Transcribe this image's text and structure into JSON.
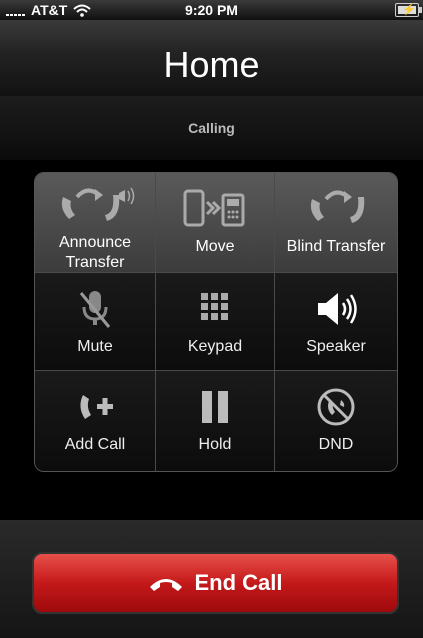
{
  "status_bar": {
    "carrier": "AT&T",
    "time": "9:20 PM"
  },
  "call": {
    "title": "Home",
    "status": "Calling"
  },
  "controls": [
    {
      "label": "Announce\nTransfer",
      "icon": "announce-transfer-icon"
    },
    {
      "label": "Move",
      "icon": "move-call-icon"
    },
    {
      "label": "Blind Transfer",
      "icon": "blind-transfer-icon"
    },
    {
      "label": "Mute",
      "icon": "mute-icon"
    },
    {
      "label": "Keypad",
      "icon": "keypad-icon"
    },
    {
      "label": "Speaker",
      "icon": "speaker-icon"
    },
    {
      "label": "Add Call",
      "icon": "add-call-icon"
    },
    {
      "label": "Hold",
      "icon": "hold-icon"
    },
    {
      "label": "DND",
      "icon": "dnd-icon"
    }
  ],
  "end_call": {
    "label": "End Call"
  },
  "colors": {
    "end_call_red": "#c4191a",
    "background": "#000000"
  }
}
